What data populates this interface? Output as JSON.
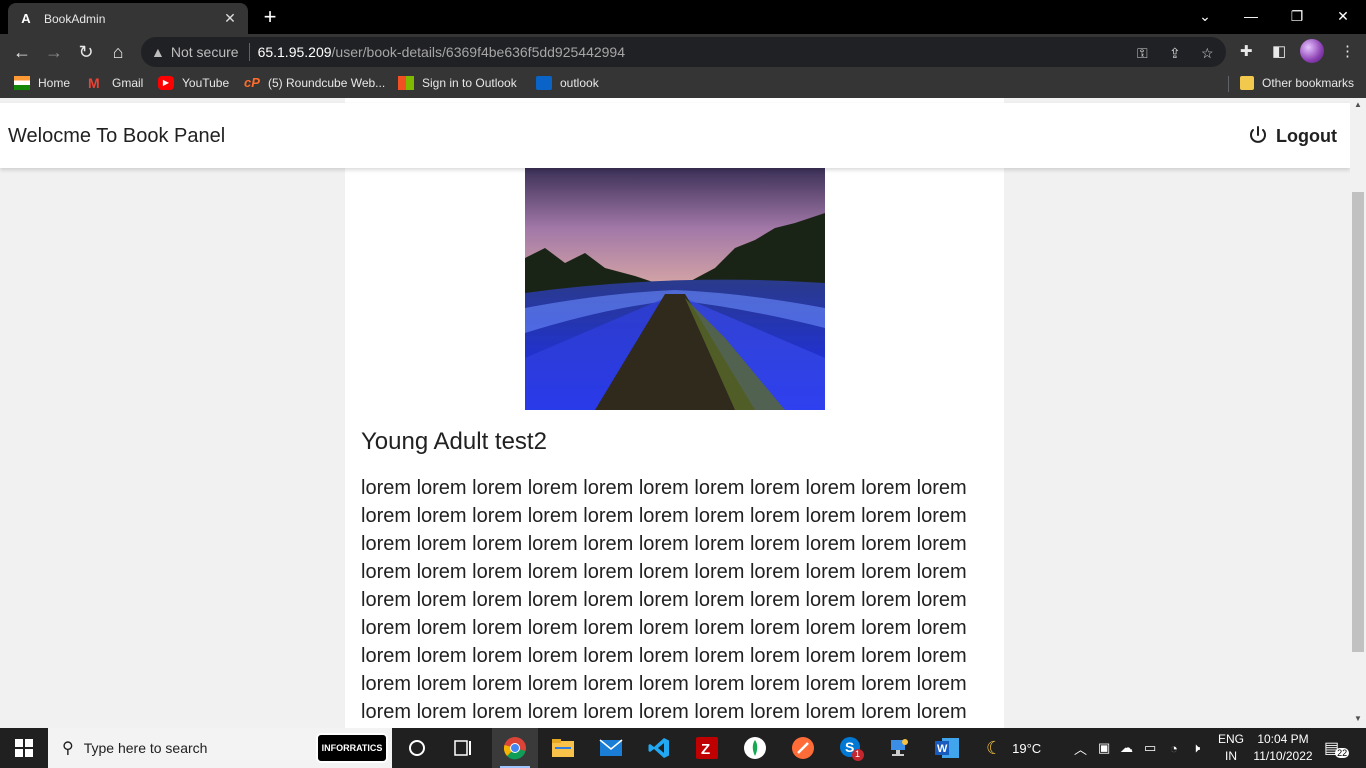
{
  "browser": {
    "tab_title": "BookAdmin",
    "security_label": "Not secure",
    "url_host": "65.1.95.209",
    "url_path": "/user/book-details/6369f4be636f5dd925442994"
  },
  "bookmarks": [
    {
      "label": "Home",
      "icon": "india-flag-icon"
    },
    {
      "label": "Gmail",
      "icon": "gmail-icon"
    },
    {
      "label": "YouTube",
      "icon": "youtube-icon"
    },
    {
      "label": "(5) Roundcube Web...",
      "icon": "cpanel-icon"
    },
    {
      "label": "Sign in to Outlook",
      "icon": "microsoft-icon"
    },
    {
      "label": "outlook",
      "icon": "outlook-icon"
    }
  ],
  "other_bookmarks": "Other bookmarks",
  "app": {
    "title": "Welocme To Book Panel",
    "logout_label": "Logout"
  },
  "book": {
    "cover_alt": "Book cover",
    "title": "Young Adult test2",
    "description": "lorem lorem lorem lorem lorem lorem lorem lorem lorem lorem lorem lorem lorem lorem lorem lorem lorem lorem lorem lorem lorem lorem lorem lorem lorem lorem lorem lorem lorem lorem lorem lorem lorem lorem lorem lorem lorem lorem lorem lorem lorem lorem lorem lorem lorem lorem lorem lorem lorem lorem lorem lorem lorem lorem lorem lorem lorem lorem lorem lorem lorem lorem lorem lorem lorem lorem lorem lorem lorem lorem lorem lorem lorem lorem lorem lorem lorem lorem lorem lorem lorem lorem lorem lorem lorem lorem lorem lorem lorem lorem lorem lorem lorem lorem lorem lorem lorem lorem lorem lorem"
  },
  "taskbar": {
    "search_placeholder": "Type here to search",
    "search_badge": "INFORRATICS",
    "weather": "19°C",
    "lang_top": "ENG",
    "lang_bottom": "IN",
    "time": "10:04 PM",
    "date": "11/10/2022",
    "notif_count": "22",
    "skype_badge": "1"
  }
}
